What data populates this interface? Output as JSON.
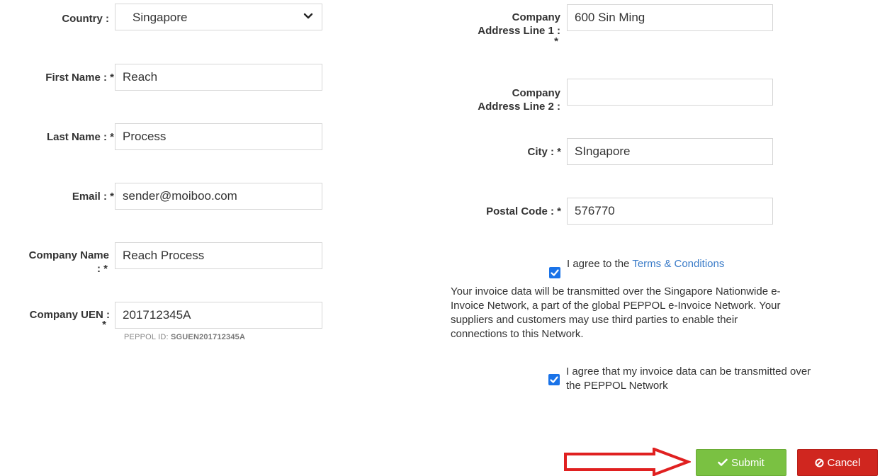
{
  "left": {
    "country": {
      "label": "Country :",
      "value": "Singapore"
    },
    "first_name": {
      "label": "First Name : *",
      "value": "Reach"
    },
    "last_name": {
      "label": "Last Name : *",
      "value": "Process"
    },
    "email": {
      "label": "Email : *",
      "value": "sender@moiboo.com"
    },
    "company_name": {
      "label_line1": "Company Name",
      "label_line2": ": *",
      "value": "Reach Process"
    },
    "company_uen": {
      "label_line1": "Company UEN :",
      "label_line2": "*",
      "value": "201712345A"
    },
    "peppol_prefix": "PEPPOL ID:",
    "peppol_id": "SGUEN201712345A"
  },
  "right": {
    "address1": {
      "label_line1": "Company",
      "label_line2": "Address Line 1 :",
      "label_line3": "*",
      "value": "600 Sin Ming"
    },
    "address2": {
      "label_line1": "Company",
      "label_line2": "Address Line 2 :",
      "value": ""
    },
    "city": {
      "label": "City : *",
      "value": "SIngapore"
    },
    "postal": {
      "label": "Postal Code : *",
      "value": "576770"
    },
    "terms_prefix": "I agree to the",
    "terms_link": "Terms & Conditions",
    "terms_checked": true,
    "notice_line1": "Your invoice data will be transmitted over the Singapore Nationwide e-",
    "notice_line2": "Invoice Network, a part of the global PEPPOL e-Invoice Network. Your",
    "notice_line3": "suppliers and customers may use third parties to enable their",
    "notice_line4": "connections to this Network.",
    "peppol_agree_line1": "I agree that my invoice data can be transmitted over",
    "peppol_agree_line2": "the PEPPOL Network",
    "peppol_checked": true
  },
  "actions": {
    "submit_label": "Submit",
    "cancel_label": "Cancel",
    "submit_color": "#7ac142",
    "cancel_color": "#d0261f",
    "arrow_color": "#e02020"
  }
}
